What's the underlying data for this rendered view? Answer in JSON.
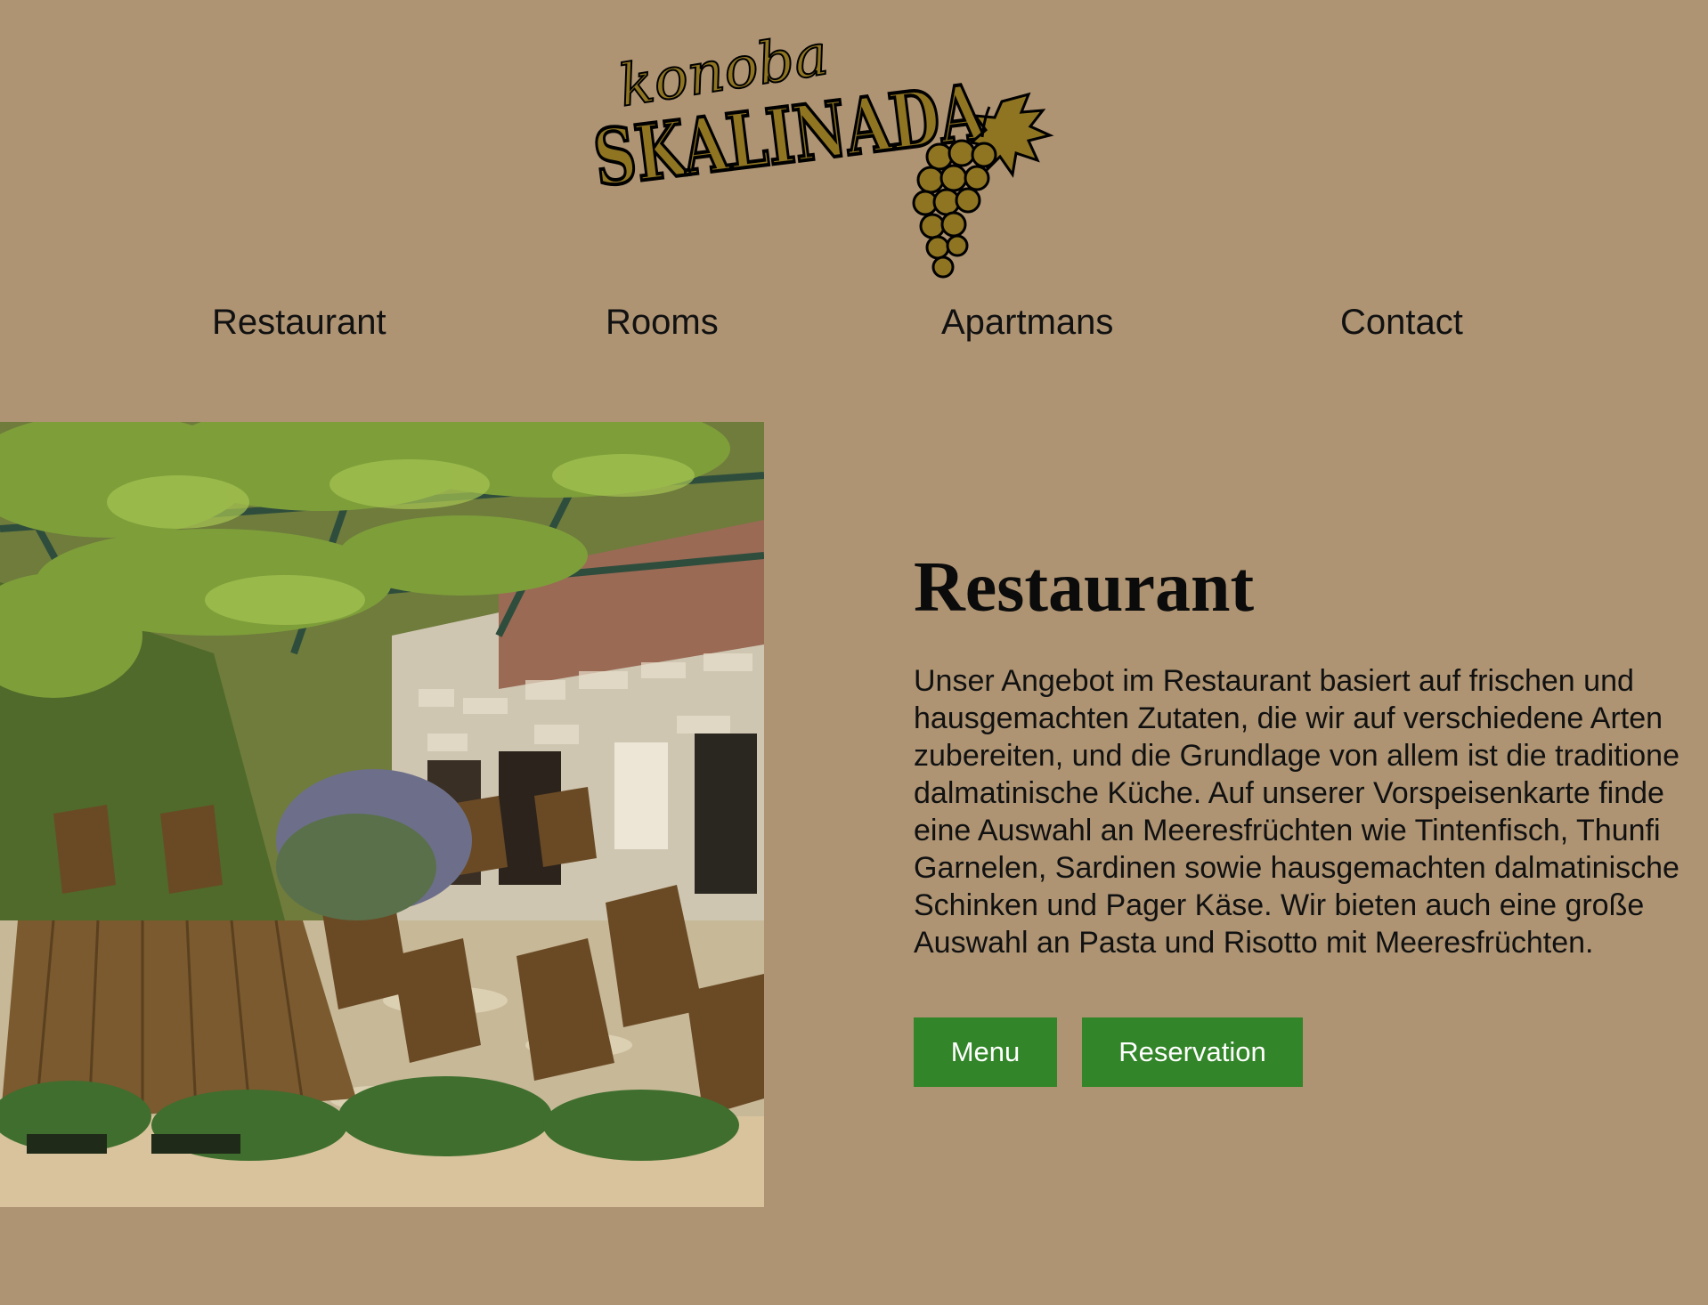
{
  "logo": {
    "script_text": "konoba",
    "main_text": "SKALINADA",
    "colors": {
      "fill": "#8f7522",
      "outline": "#000000"
    },
    "icon": "grapes-icon"
  },
  "nav": {
    "items": [
      {
        "label": "Restaurant"
      },
      {
        "label": "Rooms"
      },
      {
        "label": "Apartmans"
      },
      {
        "label": "Contact"
      }
    ]
  },
  "hero": {
    "image_alt": "terrace-photo"
  },
  "section": {
    "title": "Restaurant",
    "paragraph_lines": [
      "Unser Angebot im Restaurant basiert auf frischen und",
      "hausgemachten Zutaten, die wir auf verschiedene Arten",
      "zubereiten, und die Grundlage von allem ist die traditione",
      "dalmatinische Küche. Auf unserer Vorspeisenkarte finde",
      "eine Auswahl an Meeresfrüchten wie Tintenfisch, Thunfi",
      "Garnelen, Sardinen sowie hausgemachten dalmatinische",
      "Schinken und Pager Käse. Wir bieten auch eine große",
      "Auswahl an Pasta und Risotto mit Meeresfrüchten."
    ],
    "buttons": {
      "menu": "Menu",
      "reservation": "Reservation"
    }
  },
  "colors": {
    "background": "#ae9473",
    "button": "#328528",
    "button_text": "#ffffff"
  }
}
